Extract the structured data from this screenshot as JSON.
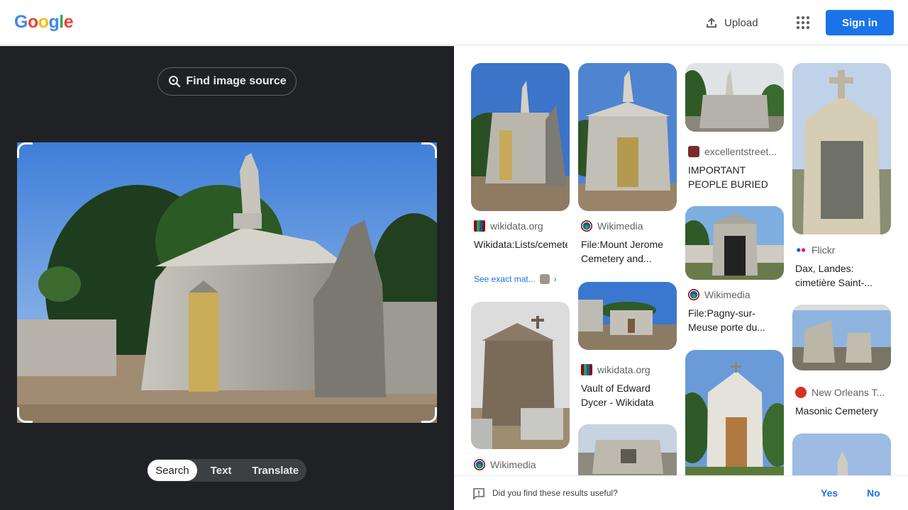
{
  "header": {
    "logo_letters": [
      "G",
      "o",
      "o",
      "g",
      "l",
      "e"
    ],
    "logo_colors": [
      "#4285F4",
      "#EA4335",
      "#FBBC05",
      "#4285F4",
      "#34A853",
      "#EA4335"
    ],
    "upload_label": "Upload",
    "signin_label": "Sign in",
    "apps_icon": "apps-grid-icon"
  },
  "left_panel": {
    "find_source_label": "Find image source",
    "modes": [
      "Search",
      "Text",
      "Translate"
    ],
    "active_mode": "Search"
  },
  "results": [
    {
      "source": "wikidata.org",
      "title": "Wikidata:Lists/cemetery/Ireland/Mou...",
      "exact_match": "See exact mat...",
      "icon": "wikidata-icon"
    },
    {
      "source": "Wikimedia",
      "title": "File:Mount Jerome Cemetery and...",
      "icon": "wikimedia-icon"
    },
    {
      "source": "excellentstreet...",
      "title": "IMPORTANT PEOPLE BURIED I...",
      "icon": "site-icon"
    },
    {
      "source": "Flickr",
      "title": "Dax, Landes: cimetière Saint-...",
      "icon": "flickr-icon"
    },
    {
      "source": "Wikimedia",
      "title": "File:Pagny-sur-Meuse porte du...",
      "icon": "wikimedia-icon"
    },
    {
      "source": "wikidata.org",
      "title": "Vault of Edward Dycer - Wikidata",
      "icon": "wikidata-icon"
    },
    {
      "source": "New Orleans T...",
      "title": "Masonic Cemetery",
      "icon": "site-icon"
    },
    {
      "source": "Wikimedia",
      "title": "",
      "icon": "wikimedia-icon"
    }
  ],
  "feedback": {
    "question": "Did you find these results useful?",
    "yes": "Yes",
    "no": "No"
  },
  "colors": {
    "accent": "#1a73e8",
    "dark_panel": "#202124"
  }
}
